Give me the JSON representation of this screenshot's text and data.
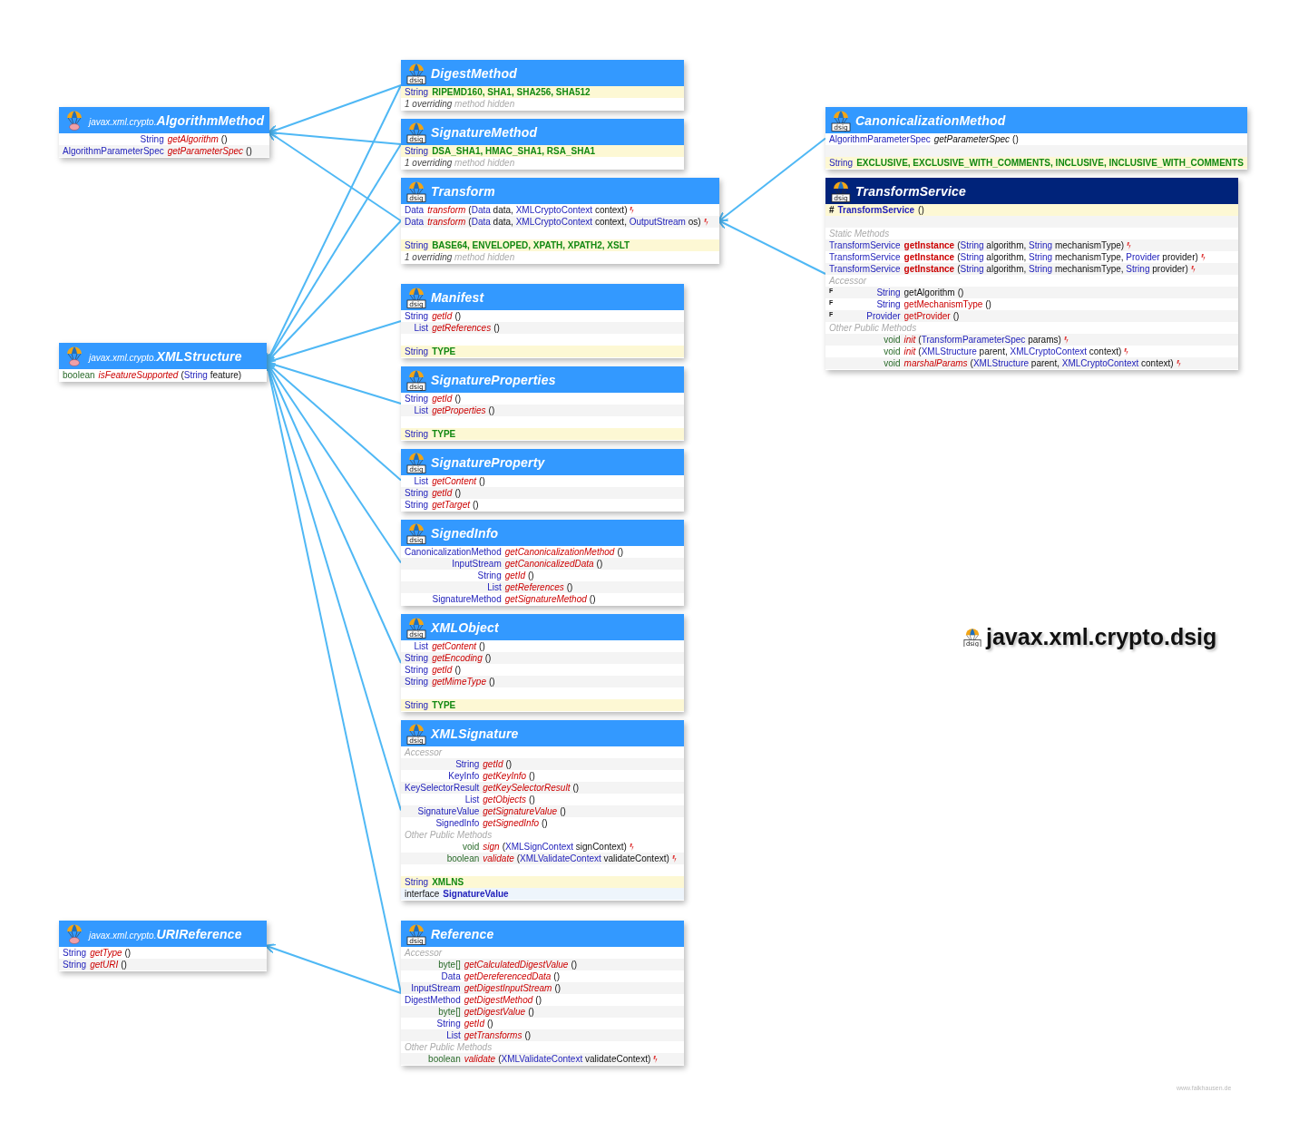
{
  "classes": [
    {
      "package": "javax.xml.crypto.",
      "name": "AlgorithmMethod",
      "kind": "interface",
      "rows": [
        {
          "kind": "abstract",
          "type": "String",
          "name": "getAlgorithm",
          "args": [
            "()"
          ]
        },
        {
          "kind": "abstract",
          "type": "AlgorithmParameterSpec",
          "name": "getParameterSpec",
          "args": [
            "()"
          ]
        }
      ]
    },
    {
      "package": "javax.xml.crypto.",
      "name": "XMLStructure",
      "kind": "interface",
      "rows": [
        {
          "kind": "abstract",
          "type": "boolean",
          "name": "isFeatureSupported",
          "args": [
            "(",
            "String",
            " feature)"
          ]
        }
      ]
    },
    {
      "package": "javax.xml.crypto.",
      "name": "URIReference",
      "kind": "interface",
      "rows": [
        {
          "kind": "abstract",
          "type": "String",
          "name": "getType",
          "args": [
            "()"
          ]
        },
        {
          "kind": "abstract",
          "type": "String",
          "name": "getURI",
          "args": [
            "()"
          ]
        }
      ]
    },
    {
      "badge": "dsig",
      "name": "DigestMethod",
      "kind": "interface",
      "rows": [
        {
          "kind": "field",
          "type": "String",
          "names": "RIPEMD160, SHA1, SHA256, SHA512"
        },
        {
          "kind": "note",
          "count": "1 overriding",
          "rest": "method hidden"
        }
      ]
    },
    {
      "badge": "dsig",
      "name": "SignatureMethod",
      "kind": "interface",
      "rows": [
        {
          "kind": "field",
          "type": "String",
          "names": "DSA_SHA1, HMAC_SHA1, RSA_SHA1"
        },
        {
          "kind": "note",
          "count": "1 overriding",
          "rest": "method hidden"
        }
      ]
    },
    {
      "badge": "dsig",
      "name": "Transform",
      "kind": "interface",
      "rows": [
        {
          "kind": "abstract",
          "type": "Data",
          "name": "transform",
          "args": [
            "(",
            "Data",
            " data, ",
            "XMLCryptoContext",
            " context)"
          ],
          "throws": true
        },
        {
          "kind": "abstract",
          "type": "Data",
          "name": "transform",
          "args": [
            "(",
            "Data",
            " data, ",
            "XMLCryptoContext",
            " context, ",
            "OutputStream",
            " os)"
          ],
          "throws": true
        },
        {
          "kind": "blank"
        },
        {
          "kind": "field",
          "type": "String",
          "names": "BASE64, ENVELOPED, XPATH, XPATH2, XSLT"
        },
        {
          "kind": "note",
          "count": "1 overriding",
          "rest": "method hidden"
        }
      ]
    },
    {
      "badge": "dsig",
      "name": "Manifest",
      "kind": "interface",
      "rows": [
        {
          "kind": "abstract",
          "type": "String",
          "name": "getId",
          "args": [
            "()"
          ]
        },
        {
          "kind": "abstract",
          "type": "List",
          "name": "getReferences",
          "args": [
            "()"
          ]
        },
        {
          "kind": "blank"
        },
        {
          "kind": "field",
          "type": "String",
          "names": "TYPE"
        }
      ]
    },
    {
      "badge": "dsig",
      "name": "SignatureProperties",
      "kind": "interface",
      "rows": [
        {
          "kind": "abstract",
          "type": "String",
          "name": "getId",
          "args": [
            "()"
          ]
        },
        {
          "kind": "abstract",
          "type": "List",
          "name": "getProperties",
          "args": [
            "()"
          ]
        },
        {
          "kind": "blank"
        },
        {
          "kind": "field",
          "type": "String",
          "names": "TYPE"
        }
      ]
    },
    {
      "badge": "dsig",
      "name": "SignatureProperty",
      "kind": "interface",
      "rows": [
        {
          "kind": "abstract",
          "type": "List",
          "name": "getContent",
          "args": [
            "()"
          ]
        },
        {
          "kind": "abstract",
          "type": "String",
          "name": "getId",
          "args": [
            "()"
          ]
        },
        {
          "kind": "abstract",
          "type": "String",
          "name": "getTarget",
          "args": [
            "()"
          ]
        }
      ]
    },
    {
      "badge": "dsig",
      "name": "SignedInfo",
      "kind": "interface",
      "rows": [
        {
          "kind": "abstract",
          "type": "CanonicalizationMethod",
          "name": "getCanonicalizationMethod",
          "args": [
            "()"
          ]
        },
        {
          "kind": "abstract",
          "type": "InputStream",
          "name": "getCanonicalizedData",
          "args": [
            "()"
          ]
        },
        {
          "kind": "abstract",
          "type": "String",
          "name": "getId",
          "args": [
            "()"
          ]
        },
        {
          "kind": "abstract",
          "type": "List",
          "name": "getReferences",
          "args": [
            "()"
          ]
        },
        {
          "kind": "abstract",
          "type": "SignatureMethod",
          "name": "getSignatureMethod",
          "args": [
            "()"
          ]
        }
      ]
    },
    {
      "badge": "dsig",
      "name": "XMLObject",
      "kind": "interface",
      "rows": [
        {
          "kind": "abstract",
          "type": "List",
          "name": "getContent",
          "args": [
            "()"
          ]
        },
        {
          "kind": "abstract",
          "type": "String",
          "name": "getEncoding",
          "args": [
            "()"
          ]
        },
        {
          "kind": "abstract",
          "type": "String",
          "name": "getId",
          "args": [
            "()"
          ]
        },
        {
          "kind": "abstract",
          "type": "String",
          "name": "getMimeType",
          "args": [
            "()"
          ]
        },
        {
          "kind": "blank"
        },
        {
          "kind": "field",
          "type": "String",
          "names": "TYPE"
        }
      ]
    },
    {
      "badge": "dsig",
      "name": "XMLSignature",
      "kind": "interface",
      "rows": [
        {
          "kind": "section",
          "label": "Accessor"
        },
        {
          "kind": "abstract",
          "type": "String",
          "name": "getId",
          "args": [
            "()"
          ]
        },
        {
          "kind": "abstract",
          "type": "KeyInfo",
          "name": "getKeyInfo",
          "args": [
            "()"
          ]
        },
        {
          "kind": "abstract",
          "type": "KeySelectorResult",
          "name": "getKeySelectorResult",
          "args": [
            "()"
          ]
        },
        {
          "kind": "abstract",
          "type": "List",
          "name": "getObjects",
          "args": [
            "()"
          ]
        },
        {
          "kind": "abstract",
          "type": "SignatureValue",
          "name": "getSignatureValue",
          "args": [
            "()"
          ]
        },
        {
          "kind": "abstract",
          "type": "SignedInfo",
          "name": "getSignedInfo",
          "args": [
            "()"
          ]
        },
        {
          "kind": "section",
          "label": "Other Public Methods"
        },
        {
          "kind": "abstract",
          "type": "void",
          "name": "sign",
          "args": [
            "(",
            "XMLSignContext",
            " signContext)"
          ],
          "throws": true
        },
        {
          "kind": "abstract",
          "type": "boolean",
          "name": "validate",
          "args": [
            "(",
            "XMLValidateContext",
            " validateContext)"
          ],
          "throws": true
        },
        {
          "kind": "blank"
        },
        {
          "kind": "field",
          "type": "String",
          "names": "XMLNS"
        },
        {
          "kind": "inner",
          "keyword": "interface",
          "name": "SignatureValue"
        }
      ]
    },
    {
      "badge": "dsig",
      "name": "Reference",
      "kind": "interface",
      "rows": [
        {
          "kind": "section",
          "label": "Accessor"
        },
        {
          "kind": "abstract",
          "type": "byte[]",
          "name": "getCalculatedDigestValue",
          "args": [
            "()"
          ]
        },
        {
          "kind": "abstract",
          "type": "Data",
          "name": "getDereferencedData",
          "args": [
            "()"
          ]
        },
        {
          "kind": "abstract",
          "type": "InputStream",
          "name": "getDigestInputStream",
          "args": [
            "()"
          ]
        },
        {
          "kind": "abstract",
          "type": "DigestMethod",
          "name": "getDigestMethod",
          "args": [
            "()"
          ]
        },
        {
          "kind": "abstract",
          "type": "byte[]",
          "name": "getDigestValue",
          "args": [
            "()"
          ]
        },
        {
          "kind": "abstract",
          "type": "String",
          "name": "getId",
          "args": [
            "()"
          ]
        },
        {
          "kind": "abstract",
          "type": "List",
          "name": "getTransforms",
          "args": [
            "()"
          ]
        },
        {
          "kind": "section",
          "label": "Other Public Methods"
        },
        {
          "kind": "abstract",
          "type": "boolean",
          "name": "validate",
          "args": [
            "(",
            "XMLValidateContext",
            " validateContext)"
          ],
          "throws": true
        }
      ]
    },
    {
      "badge": "dsig",
      "name": "CanonicalizationMethod",
      "kind": "interface",
      "rows": [
        {
          "kind": "inherited",
          "type": "AlgorithmParameterSpec",
          "name": "getParameterSpec",
          "args": [
            "()"
          ]
        },
        {
          "kind": "blank"
        },
        {
          "kind": "field",
          "type": "String",
          "names": "EXCLUSIVE, EXCLUSIVE_WITH_COMMENTS, INCLUSIVE, INCLUSIVE_WITH_COMMENTS"
        }
      ]
    },
    {
      "badge": "dsig",
      "name": "TransformService",
      "kind": "class",
      "rows": [
        {
          "kind": "constructor",
          "modifier": "#",
          "name": "TransformService",
          "args": [
            "()"
          ]
        },
        {
          "kind": "blank"
        },
        {
          "kind": "section",
          "label": "Static Methods"
        },
        {
          "kind": "static",
          "type": "TransformService",
          "name": "getInstance",
          "args": [
            "(",
            "String",
            " algorithm, ",
            "String",
            " mechanismType)"
          ],
          "throws": true
        },
        {
          "kind": "static",
          "type": "TransformService",
          "name": "getInstance",
          "args": [
            "(",
            "String",
            " algorithm, ",
            "String",
            " mechanismType, ",
            "Provider",
            " provider)"
          ],
          "throws": true
        },
        {
          "kind": "static",
          "type": "TransformService",
          "name": "getInstance",
          "args": [
            "(",
            "String",
            " algorithm, ",
            "String",
            " mechanismType, ",
            "String",
            " provider)"
          ],
          "throws": true
        },
        {
          "kind": "section",
          "label": "Accessor"
        },
        {
          "kind": "plain",
          "modifier": "F",
          "type": "String",
          "name": "getAlgorithm",
          "args": [
            "()"
          ]
        },
        {
          "kind": "concrete",
          "modifier": "F",
          "type": "String",
          "name": "getMechanismType",
          "args": [
            "()"
          ]
        },
        {
          "kind": "concrete",
          "modifier": "F",
          "type": "Provider",
          "name": "getProvider",
          "args": [
            "()"
          ]
        },
        {
          "kind": "section",
          "label": "Other Public Methods"
        },
        {
          "kind": "abstract",
          "type": "void",
          "name": "init",
          "args": [
            "(",
            "TransformParameterSpec",
            " params)"
          ],
          "throws": true
        },
        {
          "kind": "abstract",
          "type": "void",
          "name": "init",
          "args": [
            "(",
            "XMLStructure",
            " parent, ",
            "XMLCryptoContext",
            " context)"
          ],
          "throws": true
        },
        {
          "kind": "abstract",
          "type": "void",
          "name": "marshalParams",
          "args": [
            "(",
            "XMLStructure",
            " parent, ",
            "XMLCryptoContext",
            " context)"
          ],
          "throws": true
        }
      ]
    }
  ],
  "package_title": {
    "badge": "dsig",
    "name": "javax.xml.crypto.dsig"
  },
  "credit": "www.falkhausen.de"
}
